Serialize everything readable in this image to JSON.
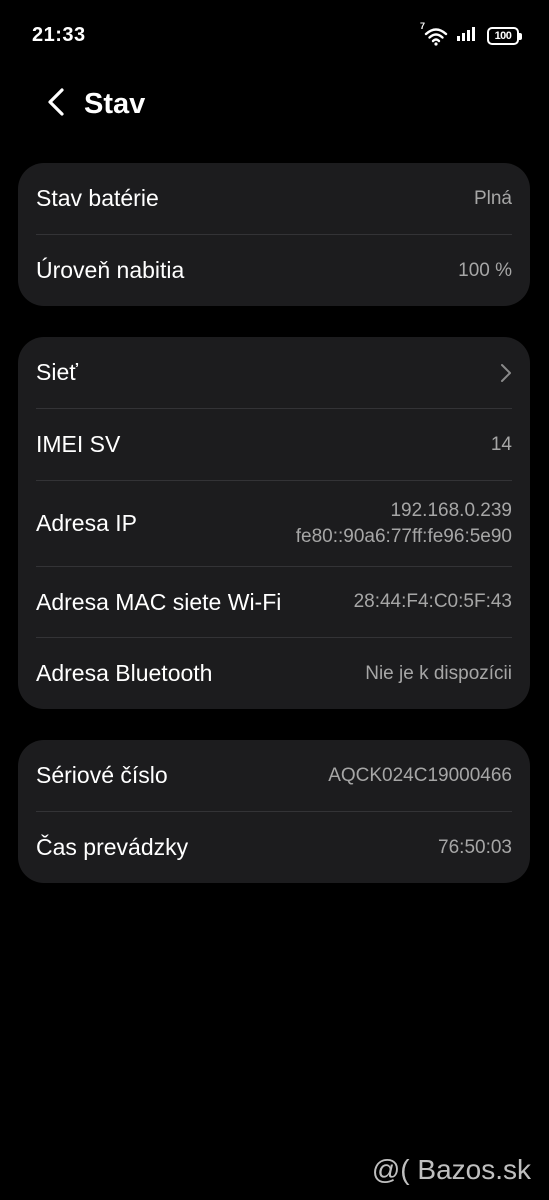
{
  "status_bar": {
    "time": "21:33",
    "battery": "100",
    "wifi_badge": "7",
    "icons": [
      "wifi-icon",
      "signal-icon",
      "battery-icon"
    ]
  },
  "header": {
    "title": "Stav",
    "back_icon": "chevron-left-icon"
  },
  "colors": {
    "background": "#000000",
    "card": "#1c1c1e",
    "text_primary": "#ffffff",
    "text_secondary": "#a6a6a6",
    "divider": "#333336"
  },
  "battery_card": {
    "rows": [
      {
        "label": "Stav batérie",
        "value": "Plná"
      },
      {
        "label": "Úroveň nabitia",
        "value": "100 %"
      }
    ]
  },
  "network_card": {
    "rows": [
      {
        "label": "Sieť",
        "icon": "chevron-right-icon"
      },
      {
        "label": "IMEI SV",
        "value": "14"
      },
      {
        "label": "Adresa IP",
        "value_lines": [
          "192.168.0.239",
          "fe80::90a6:77ff:fe96:5e90"
        ]
      },
      {
        "label": "Adresa MAC siete Wi-Fi",
        "value": "28:44:F4:C0:5F:43"
      },
      {
        "label": "Adresa Bluetooth",
        "value": "Nie je k dispozícii"
      }
    ]
  },
  "device_card": {
    "rows": [
      {
        "label": "Sériové číslo",
        "value": "AQCK024C19000466"
      },
      {
        "label": "Čas prevádzky",
        "value": "76:50:03"
      }
    ]
  },
  "watermark": "@( Bazos.sk"
}
